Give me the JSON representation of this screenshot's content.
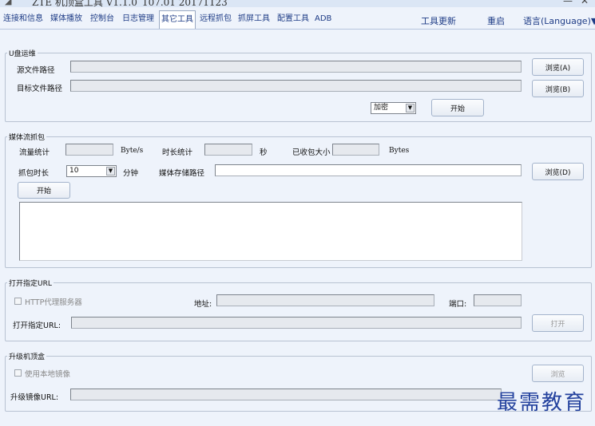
{
  "window": {
    "title": "ZTE 机顶盒工具 V1.1.0_107.01 20171123",
    "minimize_glyph": "—",
    "close_glyph": "✕",
    "icon": "app-icon"
  },
  "menubar": {
    "tabs": [
      {
        "label": "连接和信息"
      },
      {
        "label": "媒体播放"
      },
      {
        "label": "控制台"
      },
      {
        "label": "日志管理"
      },
      {
        "label": "其它工具",
        "active": true
      },
      {
        "label": "远程抓包"
      },
      {
        "label": "抓屏工具"
      },
      {
        "label": "配置工具"
      },
      {
        "label": "ADB"
      }
    ],
    "update_label": "工具更新",
    "restart_label": "重启",
    "language_label": "语言(Language)▼"
  },
  "usb": {
    "group_title": "U盘运维",
    "source_label": "源文件路径",
    "source_value": "",
    "target_label": "目标文件路径",
    "target_value": "",
    "browse_a": "浏览(A)",
    "browse_b": "浏览(B)",
    "mode_value": "加密",
    "start_label": "开始"
  },
  "stream": {
    "group_title": "媒体流抓包",
    "traffic_label": "流量统计",
    "traffic_value": "",
    "traffic_unit": "Byte/s",
    "duration_stat_label": "时长统计",
    "duration_stat_value": "",
    "duration_unit": "秒",
    "received_label": "已收包大小",
    "received_value": "",
    "received_unit": "Bytes",
    "capture_duration_label": "抓包时长",
    "capture_duration_value": "10",
    "minutes_label": "分钟",
    "storage_label": "媒体存储路径",
    "storage_value": "",
    "browse_d": "浏览(D)",
    "start_label": "开始",
    "log_text": ""
  },
  "url": {
    "group_title": "打开指定URL",
    "proxy_label": "HTTP代理服务器",
    "address_label": "地址:",
    "address_value": "",
    "port_label": "端口:",
    "port_value": "",
    "open_url_label": "打开指定URL:",
    "open_url_value": "",
    "open_button": "打开"
  },
  "upgrade": {
    "group_title": "升级机顶盒",
    "local_image_label": "使用本地镜像",
    "browse_button": "浏览",
    "image_url_label": "升级镜像URL:",
    "image_url_value": ""
  },
  "watermark": "最需教育",
  "colors": {
    "background": "#eef3fb",
    "tab_text": "#1e3c86",
    "watermark": "#24429e"
  }
}
